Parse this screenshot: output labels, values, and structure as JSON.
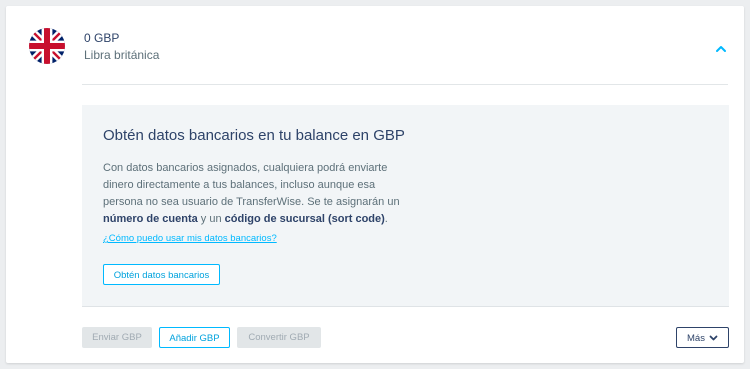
{
  "balance": {
    "amount": "0 GBP",
    "currency_name": "Libra británica",
    "flag_icon": "uk-flag-icon",
    "toggle_icon": "chevron-up-icon"
  },
  "bank_details_panel": {
    "title": "Obtén datos bancarios en tu balance en GBP",
    "description_intro": "Con datos bancarios asignados, cualquiera podrá enviarte dinero directamente a tus balances, incluso aunque esa persona no sea usuario de TransferWise. Se te asignarán un ",
    "account_number": "número de cuenta",
    "connector": " y un ",
    "sort_code": "código de sucursal (sort code)",
    "period": ".",
    "help_link": "¿Cómo puedo usar mis datos bancarios?",
    "get_details_button": "Obtén datos bancarios"
  },
  "actions": {
    "send": "Enviar GBP",
    "add": "Añadir GBP",
    "convert": "Convertir GBP",
    "more": "Más",
    "more_icon": "chevron-down-icon"
  },
  "colors": {
    "accent": "#00b9ff",
    "text_primary": "#2e4369",
    "text_secondary": "#5d7079",
    "panel_background": "#f2f5f7",
    "disabled_button": "#e2e6e8"
  }
}
